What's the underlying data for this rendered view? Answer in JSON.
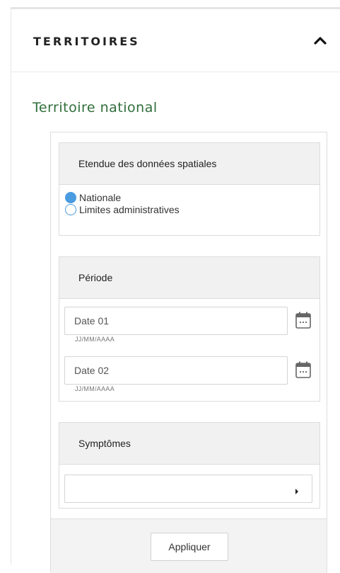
{
  "panel": {
    "title": "TERRITOIRES",
    "collapse_icon": "chevron-up-icon"
  },
  "section_title": "Territoire national",
  "spatial_extent": {
    "heading": "Etendue des données spatiales",
    "options": [
      {
        "label": "Nationale",
        "selected": true
      },
      {
        "label": "Limites administratives",
        "selected": false
      }
    ]
  },
  "period": {
    "heading": "Période",
    "date1": {
      "placeholder": "Date 01",
      "format_hint": "JJ/MM/AAAA"
    },
    "date2": {
      "placeholder": "Date 02",
      "format_hint": "JJ/MM/AAAA"
    },
    "calendar_icon": "calendar-icon"
  },
  "symptoms": {
    "heading": "Symptômes",
    "selected_value": "",
    "dropdown_icon": "caret-right-icon"
  },
  "footer": {
    "apply_label": "Appliquer"
  },
  "colors": {
    "section_title": "#2f6e3a",
    "radio_accent": "#4a9be0",
    "card_header_bg": "#f1f1f1"
  }
}
